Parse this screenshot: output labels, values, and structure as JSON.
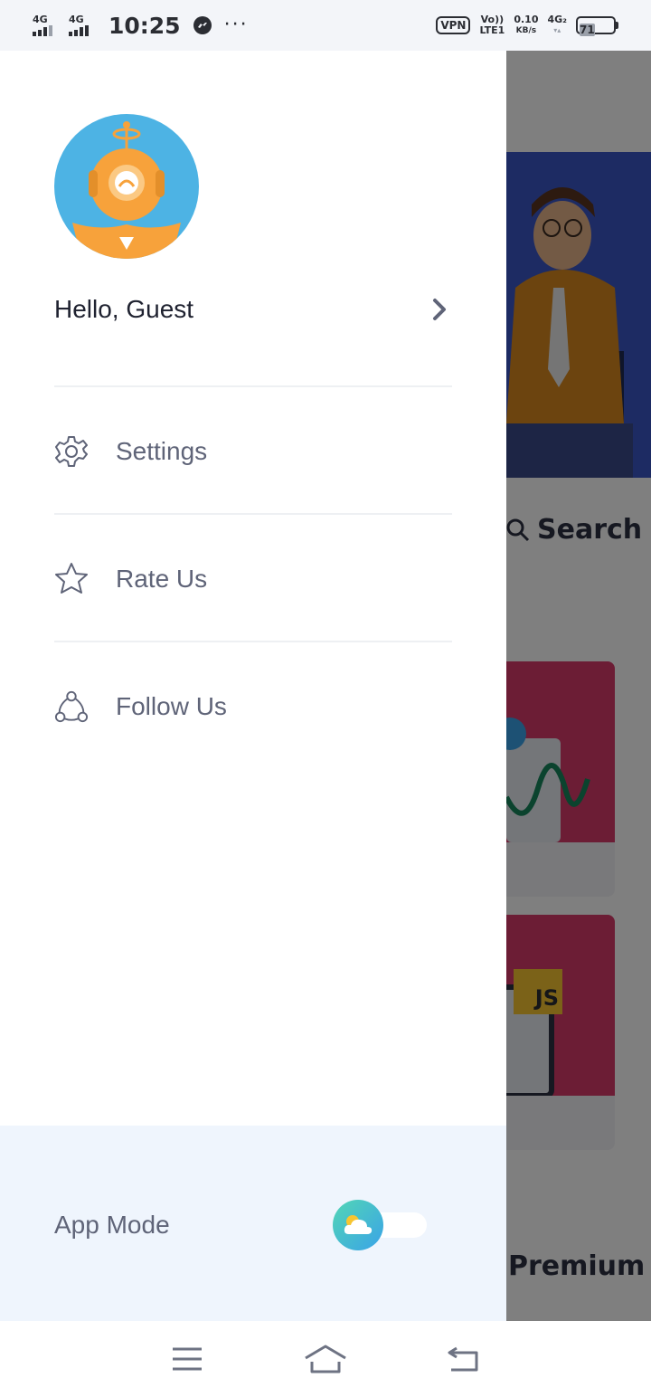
{
  "status_bar": {
    "sim1_network": "4G",
    "sim2_network": "4G",
    "time": "10:25",
    "vpn": "VPN",
    "volte_top": "Vo))",
    "volte_bottom": "LTE1",
    "speed_value": "0.10",
    "speed_unit": "KB/s",
    "network2_top": "4G₂",
    "network2_bottom": "▾▴",
    "battery_level": "71"
  },
  "drawer": {
    "greeting": "Hello, Guest",
    "menu": [
      {
        "label": "Settings",
        "icon": "gear-icon"
      },
      {
        "label": "Rate Us",
        "icon": "star-icon"
      },
      {
        "label": "Follow Us",
        "icon": "share-icon"
      }
    ],
    "app_mode": {
      "label": "App Mode",
      "state": "light"
    }
  },
  "background": {
    "search_label": "Search",
    "card_badge": "JS",
    "premium_label": "Premium"
  },
  "colors": {
    "accent_blue": "#3aa3e8",
    "accent_teal": "#52d6b5",
    "avatar_orange": "#f7a23b",
    "panel_bg": "#eff5fd"
  }
}
